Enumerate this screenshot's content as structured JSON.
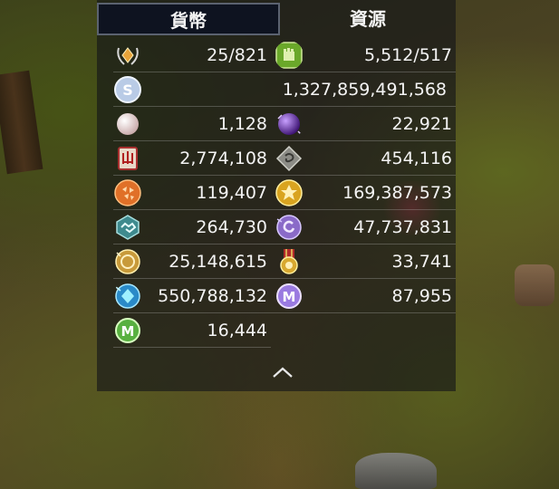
{
  "tabs": {
    "currency": "貨幣",
    "resources": "資源"
  },
  "rows": [
    {
      "left": {
        "icon": "wreath-diamond-icon",
        "value": "25/821"
      },
      "right": {
        "icon": "green-fist-icon",
        "value": "5,512/517"
      }
    },
    {
      "wide": {
        "icon": "silver-s-coin-icon",
        "value": "1,327,859,491,568"
      }
    },
    {
      "left": {
        "icon": "pearl-icon",
        "value": "1,128"
      },
      "right": {
        "icon": "purple-orb-icon",
        "value": "22,921"
      }
    },
    {
      "left": {
        "icon": "red-scroll-icon",
        "value": "2,774,108"
      },
      "right": {
        "icon": "gray-rune-stone-icon",
        "value": "454,116"
      }
    },
    {
      "left": {
        "icon": "orange-fragments-icon",
        "value": "119,407"
      },
      "right": {
        "icon": "gold-crest-icon",
        "value": "169,387,573"
      }
    },
    {
      "left": {
        "icon": "teal-handshake-icon",
        "value": "264,730"
      },
      "right": {
        "icon": "purple-swirl-icon",
        "value": "47,737,831"
      }
    },
    {
      "left": {
        "icon": "gold-coin-icon",
        "value": "25,148,615"
      },
      "right": {
        "icon": "medal-icon",
        "value": "33,741"
      }
    },
    {
      "left": {
        "icon": "blue-gem-icon",
        "value": "550,788,132"
      },
      "right": {
        "icon": "purple-m-coin-icon",
        "value": "87,955"
      }
    },
    {
      "left": {
        "icon": "green-m-coin-icon",
        "value": "16,444"
      }
    }
  ],
  "collapse_icon": "chevron-up-icon"
}
